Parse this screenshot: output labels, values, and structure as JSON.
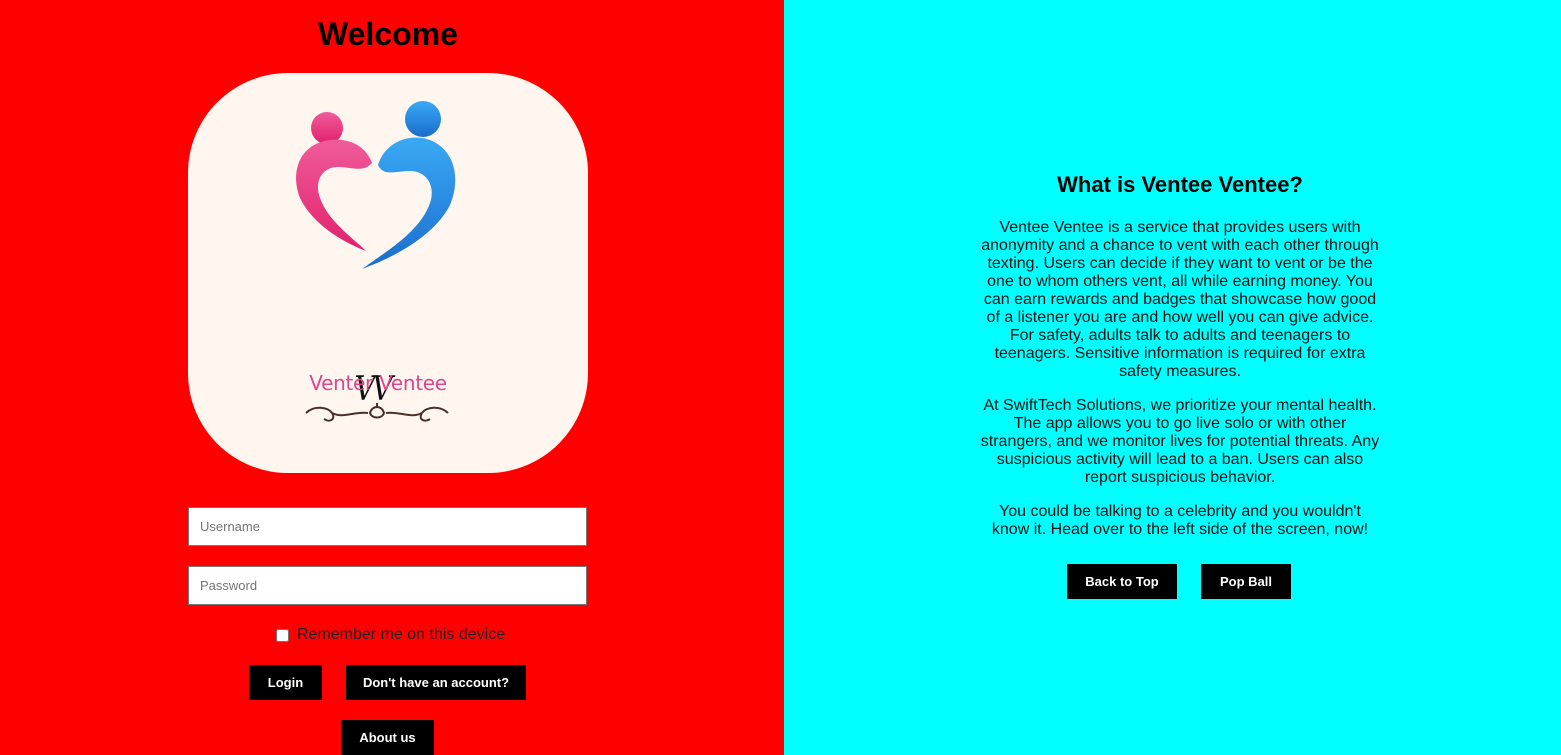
{
  "login": {
    "title": "Welcome",
    "logo": {
      "monogram": "VV",
      "brand": "Venter Ventee"
    },
    "username_placeholder": "Username",
    "password_placeholder": "Password",
    "remember_label": "Remember me on this device",
    "login_label": "Login",
    "signup_label": "Don't have an account?",
    "about_label": "About us"
  },
  "info": {
    "heading": "What is Ventee Ventee?",
    "paragraphs": [
      "Ventee Ventee is a service that provides users with anonymity and a chance to vent with each other through texting. Users can decide if they want to vent or be the one to whom others vent, all while earning money. You can earn rewards and badges that showcase how good of a listener you are and how well you can give advice. For safety, adults talk to adults and teenagers to teenagers. Sensitive information is required for extra safety measures.",
      "At SwiftTech Solutions, we prioritize your mental health. The app allows you to go live solo or with other strangers, and we monitor lives for potential threats. Any suspicious activity will lead to a ban. Users can also report suspicious behavior.",
      "You could be talking to a celebrity and you wouldn't know it. Head over to the left side of the screen, now!"
    ],
    "back_to_top_label": "Back to Top",
    "pop_ball_label": "Pop Ball"
  },
  "colors": {
    "left_panel": "#ff0000",
    "right_panel": "#00ffff",
    "logo_pink": "#e0448a",
    "logo_blue": "#2a8ee8",
    "button_bg": "#000000"
  }
}
